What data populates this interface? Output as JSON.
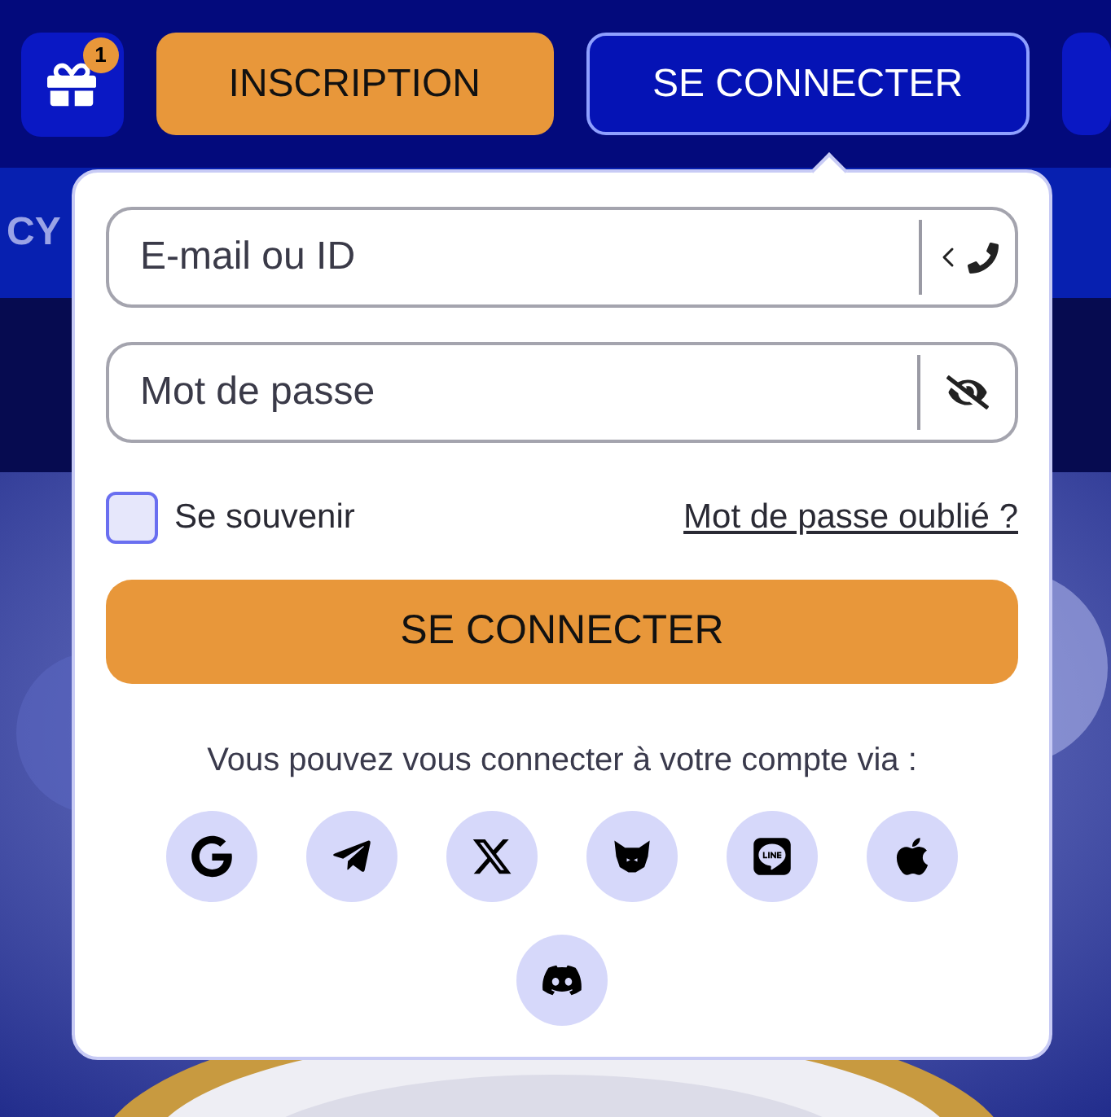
{
  "header": {
    "gift_badge": "1",
    "register_button": "INSCRIPTION",
    "login_button": "SE CONNECTER"
  },
  "nav": {
    "item": "CY"
  },
  "login_popover": {
    "email_field": {
      "placeholder": "E-mail ou ID"
    },
    "password_field": {
      "placeholder": "Mot de passe"
    },
    "remember": {
      "label": "Se souvenir",
      "checked": false
    },
    "forgot_link": "Mot de passe oublié ?",
    "submit_button": "SE CONNECTER",
    "social_prompt": "Vous pouvez vous connecter à votre compte via :"
  }
}
